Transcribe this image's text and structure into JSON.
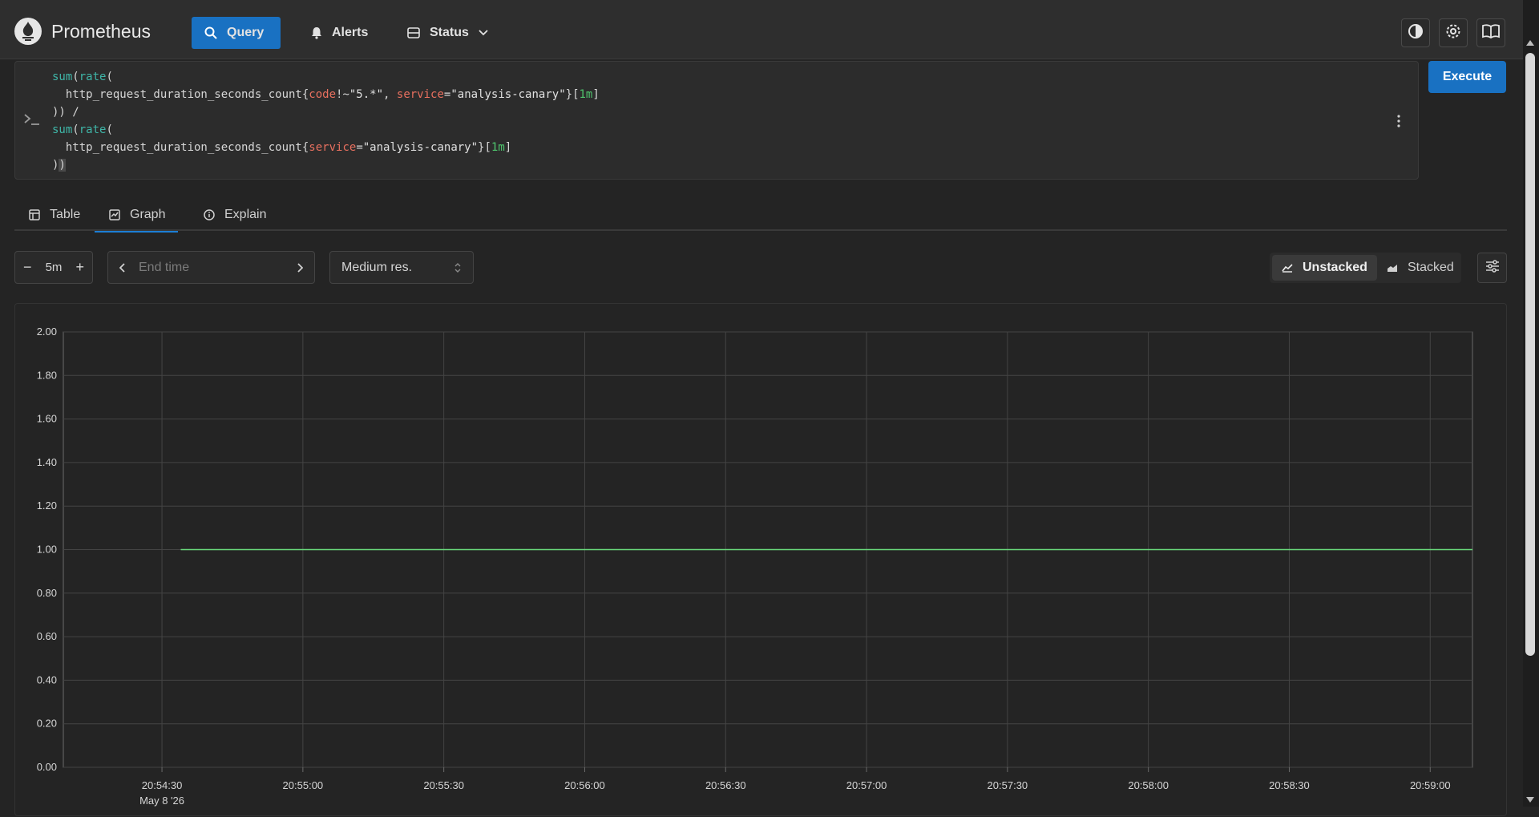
{
  "header": {
    "brand": "Prometheus",
    "nav": {
      "query": "Query",
      "alerts": "Alerts",
      "status": "Status"
    },
    "accent": "#1971c2"
  },
  "editor": {
    "lines": [
      [
        {
          "t": "sum",
          "c": "fn"
        },
        {
          "t": "(",
          "c": "op"
        },
        {
          "t": "rate",
          "c": "fn"
        },
        {
          "t": "(",
          "c": "op"
        }
      ],
      [
        {
          "t": "  http_request_duration_seconds_count{",
          "c": "op"
        },
        {
          "t": "code",
          "c": "lbl"
        },
        {
          "t": "!~",
          "c": "op"
        },
        {
          "t": "\"5.*\"",
          "c": "str"
        },
        {
          "t": ", ",
          "c": "op"
        },
        {
          "t": "service",
          "c": "lbl"
        },
        {
          "t": "=",
          "c": "op"
        },
        {
          "t": "\"analysis-canary\"",
          "c": "str"
        },
        {
          "t": "}[",
          "c": "op"
        },
        {
          "t": "1m",
          "c": "dur"
        },
        {
          "t": "]",
          "c": "op"
        }
      ],
      [
        {
          "t": ")) /",
          "c": "op"
        }
      ],
      [
        {
          "t": "sum",
          "c": "fn"
        },
        {
          "t": "(",
          "c": "op"
        },
        {
          "t": "rate",
          "c": "fn"
        },
        {
          "t": "(",
          "c": "op"
        }
      ],
      [
        {
          "t": "  http_request_duration_seconds_count{",
          "c": "op"
        },
        {
          "t": "service",
          "c": "lbl"
        },
        {
          "t": "=",
          "c": "op"
        },
        {
          "t": "\"analysis-canary\"",
          "c": "str"
        },
        {
          "t": "}[",
          "c": "op"
        },
        {
          "t": "1m",
          "c": "dur"
        },
        {
          "t": "]",
          "c": "op"
        }
      ],
      [
        {
          "t": ")",
          "c": "op"
        },
        {
          "t": ")",
          "c": "cursor"
        }
      ]
    ],
    "execute_label": "Execute"
  },
  "tabs": {
    "table": "Table",
    "graph": "Graph",
    "explain": "Explain",
    "active": "Graph"
  },
  "controls": {
    "range_value": "5m",
    "range_minus": "−",
    "range_plus": "+",
    "end_time_placeholder": "End time",
    "resolution": "Medium res.",
    "unstacked": "Unstacked",
    "stacked": "Stacked",
    "stack_mode": "Unstacked"
  },
  "chart_data": {
    "type": "line",
    "ylim": [
      0,
      2
    ],
    "yticks": [
      "0.00",
      "0.20",
      "0.40",
      "0.60",
      "0.80",
      "1.00",
      "1.20",
      "1.40",
      "1.60",
      "1.80",
      "2.00"
    ],
    "xticks": [
      "20:54:30",
      "20:55:00",
      "20:55:30",
      "20:56:00",
      "20:56:30",
      "20:57:00",
      "20:57:30",
      "20:58:00",
      "20:58:30",
      "20:59:00"
    ],
    "x_date_label": "May 8 '26",
    "x_start": "20:54:09",
    "x_end": "20:59:09",
    "series": [
      {
        "color": "#69db7c",
        "x": [
          "20:54:34",
          "20:59:09"
        ],
        "values": [
          1.0,
          1.0
        ]
      }
    ],
    "grid": true
  }
}
